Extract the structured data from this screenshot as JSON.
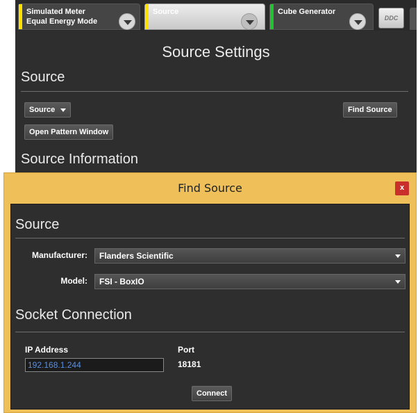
{
  "tabs": [
    {
      "line1": "Simulated Meter",
      "line2": "Equal Energy Mode",
      "accent": "#ffe100"
    },
    {
      "line1": "Source",
      "line2": "",
      "accent": "#ffe100"
    },
    {
      "line1": "Cube Generator",
      "line2": "",
      "accent": "#22c230"
    }
  ],
  "ddc_label": "DDC",
  "settings": {
    "title": "Source Settings",
    "source_heading": "Source",
    "source_dropdown": "Source",
    "find_source_button": "Find Source",
    "open_pattern_button": "Open Pattern Window",
    "info_heading": "Source Information"
  },
  "dialog": {
    "title": "Find Source",
    "close_label": "x",
    "source_heading": "Source",
    "manufacturer_label": "Manufacturer:",
    "manufacturer_value": "Flanders Scientific",
    "model_label": "Model:",
    "model_value": "FSI - BoxIO",
    "socket_heading": "Socket Connection",
    "ip_label": "IP Address",
    "ip_value": "192.168.1.244",
    "port_label": "Port",
    "port_value": "18181",
    "connect_button": "Connect"
  },
  "colors": {
    "dialog_frame": "#efc059",
    "panel": "#2e2e2e",
    "close": "#c9302c",
    "ip_text": "#5b8fe0"
  },
  "icons": [
    "chevron-down-icon",
    "dropdown-arrow-icon",
    "close-icon"
  ]
}
